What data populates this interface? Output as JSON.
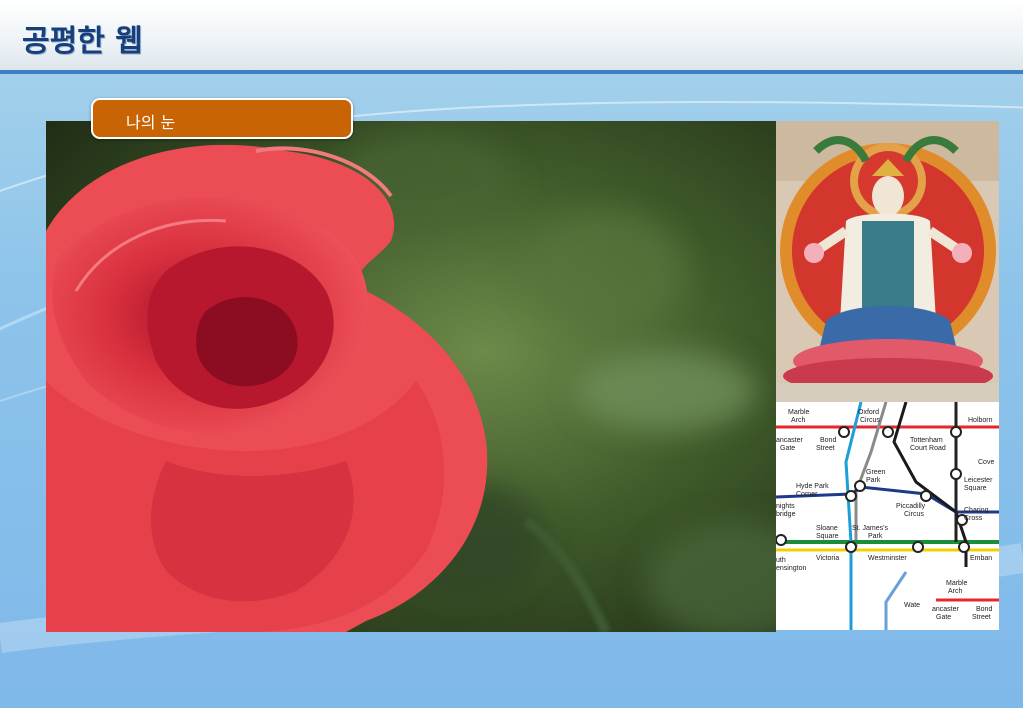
{
  "header": {
    "title": "공평한 웹"
  },
  "slide": {
    "label": "나의 눈"
  },
  "map": {
    "stations": [
      "Marble Arch",
      "Oxford Circus",
      "Holborn",
      "Lancaster Gate",
      "Bond Street",
      "Tottenham Court Road",
      "Green Park",
      "Covent",
      "Hyde Park Corner",
      "Leicester Square",
      "Knightsbridge",
      "Piccadilly Circus",
      "Charing Cross",
      "Sloane Square",
      "St. James's Park",
      "South Kensington",
      "Victoria",
      "Westminster",
      "Embankment",
      "Marble Arch",
      "Lancaster Gate",
      "Bond Street",
      "Waterloo"
    ]
  },
  "colors": {
    "header_bar": "#3f7fc4",
    "title": "#163f7c",
    "label_bg": "#c86404",
    "rose": "#e8404a"
  }
}
